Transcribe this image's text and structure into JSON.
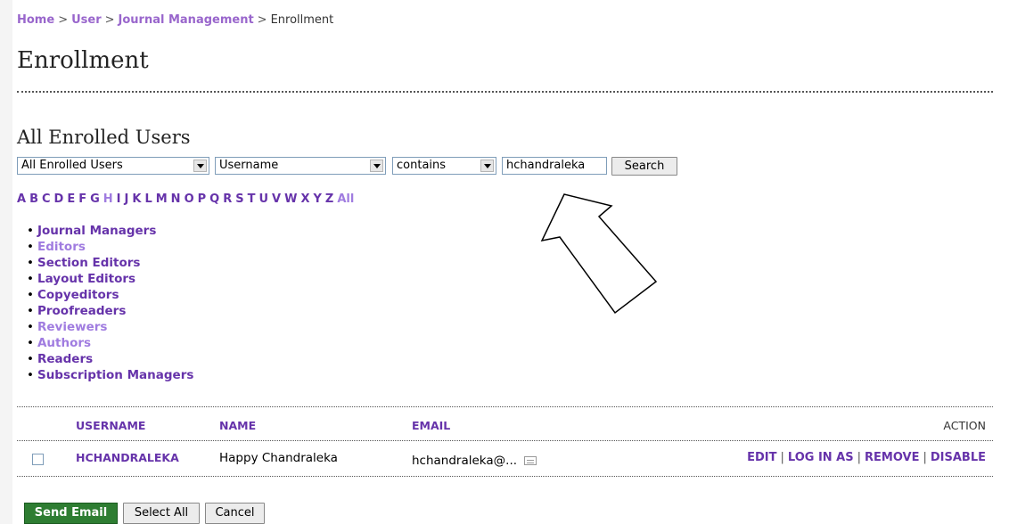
{
  "breadcrumb": {
    "home": "Home",
    "user": "User",
    "journal_management": "Journal Management",
    "current": "Enrollment",
    "separator": ">"
  },
  "page_title": "Enrollment",
  "section_title": "All Enrolled Users",
  "search": {
    "scope_select": "All Enrolled Users",
    "field_select": "Username",
    "match_select": "contains",
    "query_value": "hchandraleka",
    "search_label": "Search"
  },
  "letters": [
    "A",
    "B",
    "C",
    "D",
    "E",
    "F",
    "G",
    "H",
    "I",
    "J",
    "K",
    "L",
    "M",
    "N",
    "O",
    "P",
    "Q",
    "R",
    "S",
    "T",
    "U",
    "V",
    "W",
    "X",
    "Y",
    "Z",
    "All"
  ],
  "roles": [
    {
      "label": "Journal Managers",
      "active": false
    },
    {
      "label": "Editors",
      "active": true
    },
    {
      "label": "Section Editors",
      "active": false
    },
    {
      "label": "Layout Editors",
      "active": false
    },
    {
      "label": "Copyeditors",
      "active": false
    },
    {
      "label": "Proofreaders",
      "active": false
    },
    {
      "label": "Reviewers",
      "active": true
    },
    {
      "label": "Authors",
      "active": true
    },
    {
      "label": "Readers",
      "active": false
    },
    {
      "label": "Subscription Managers",
      "active": false
    }
  ],
  "table": {
    "headers": {
      "username": "USERNAME",
      "name": "NAME",
      "email": "EMAIL",
      "action": "ACTION"
    },
    "rows": [
      {
        "username": "HCHANDRALEKA",
        "name": "Happy Chandraleka",
        "email": "hchandraleka@..."
      }
    ],
    "actions": {
      "edit": "EDIT",
      "log_in_as": "LOG IN AS",
      "remove": "REMOVE",
      "disable": "DISABLE"
    }
  },
  "footer_buttons": {
    "send_email": "Send Email",
    "select_all": "Select All",
    "cancel": "Cancel"
  },
  "colors": {
    "link": "#6633aa",
    "link_light": "#a07ce0",
    "send_button": "#2e7d32"
  }
}
